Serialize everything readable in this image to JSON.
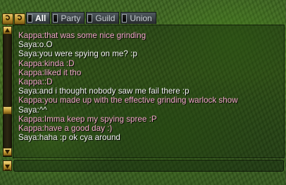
{
  "tabs": [
    {
      "label": "All",
      "active": true
    },
    {
      "label": "Party",
      "active": false
    },
    {
      "label": "Guild",
      "active": false
    },
    {
      "label": "Union",
      "active": false
    }
  ],
  "colors": {
    "kappa": "#f2a9c9",
    "saya": "#f3f3f3"
  },
  "scroll": {
    "position_fraction": 0.68
  },
  "messages": [
    {
      "speaker": "Kappa",
      "text": "Kappa:that was some nice grinding"
    },
    {
      "speaker": "Saya",
      "text": "Saya:o.O"
    },
    {
      "speaker": "Saya",
      "text": "Saya:you were spying on me? :p"
    },
    {
      "speaker": "Kappa",
      "text": "Kappa:kinda :D"
    },
    {
      "speaker": "Kappa",
      "text": "Kappa:liked it tho"
    },
    {
      "speaker": "Kappa",
      "text": "Kappa::D"
    },
    {
      "speaker": "Saya",
      "text": "Saya:and i thought nobody saw me fail there :p"
    },
    {
      "speaker": "Kappa",
      "text": "Kappa:you made up with the effective grinding warlock show"
    },
    {
      "speaker": "Saya",
      "text": "Saya:^^"
    },
    {
      "speaker": "Kappa",
      "text": "Kappa:Imma keep my spying spree :P"
    },
    {
      "speaker": "Kappa",
      "text": "Kappa:have a good day :)"
    },
    {
      "speaker": "Saya",
      "text": "Saya:haha :p ok cya around"
    }
  ],
  "input": {
    "value": ""
  }
}
